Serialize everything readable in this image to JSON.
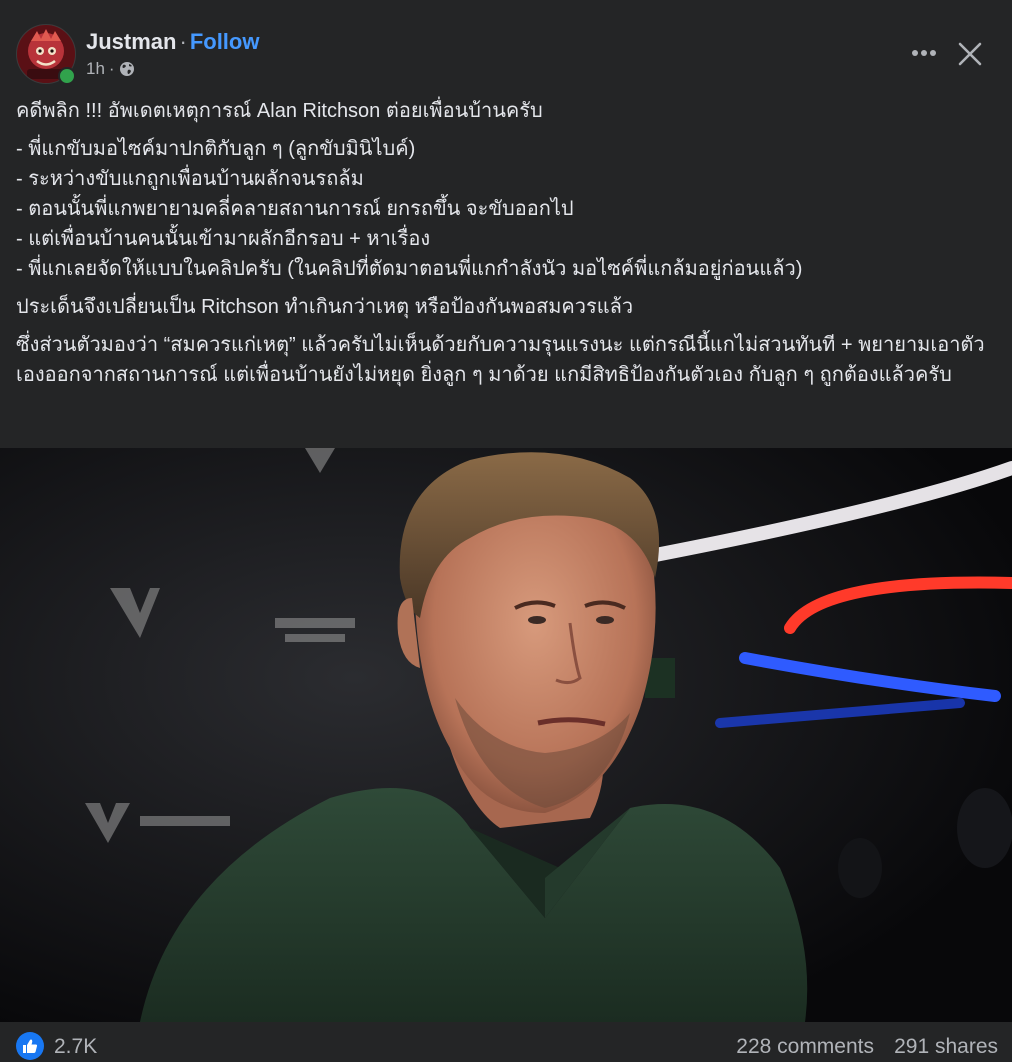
{
  "author": {
    "name": "Justman",
    "separator": "·",
    "follow_label": "Follow",
    "time": "1h",
    "time_separator": "·",
    "privacy_icon": "globe-icon",
    "online": true
  },
  "header_actions": {
    "more_icon": "more-horizontal-icon",
    "close_icon": "close-icon"
  },
  "post": {
    "headline": "คดีพลิก !!! อัพเดตเหตุการณ์ Alan Ritchson ต่อยเพื่อนบ้านครับ",
    "bullets": [
      "- พี่แกขับมอไซค์มาปกติกับลูก ๆ (ลูกขับมินิไบค์)",
      "- ระหว่างขับแกถูกเพื่อนบ้านผลักจนรถล้ม",
      "- ตอนนั้นพี่แกพยายามคลี่คลายสถานการณ์ ยกรถขึ้น จะขับออกไป",
      "- แต่เพื่อนบ้านคนนั้นเข้ามาผลักอีกรอบ + หาเรื่อง",
      "- พี่แกเลยจัดให้แบบในคลิปครับ (ในคลิปที่ตัดมาตอนพี่แกกำลังนัว มอไซค์พี่แกล้มอยู่ก่อนแล้ว)"
    ],
    "paragraph_1": "ประเด็นจึงเปลี่ยนเป็น Ritchson ทำเกินกว่าเหตุ หรือป้องกันพอสมควรแล้ว",
    "paragraph_2": "ซึ่งส่วนตัวมองว่า “สมควรแก่เหตุ” แล้วครับไม่เห็นด้วยกับความรุนแรงนะ แต่กรณีนี้แกไม่สวนทันที + พยายามเอาตัวเองออกจากสถานการณ์ แต่เพื่อนบ้านยังไม่หยุด ยิ่งลูก ๆ มาด้วย แกมีสิทธิป้องกันตัวเอง กับลูก ๆ ถูกต้องแล้วครับ"
  },
  "footer": {
    "reaction_icon": "like-icon",
    "reactions": "2.7K",
    "comments": "228 comments",
    "shares": "291 shares"
  },
  "colors": {
    "card_bg": "#242526",
    "text_primary": "#e4e6eb",
    "text_secondary": "#b0b3b8",
    "link_blue": "#4599ff",
    "like_blue": "#1877f2",
    "online_green": "#31a24c"
  }
}
